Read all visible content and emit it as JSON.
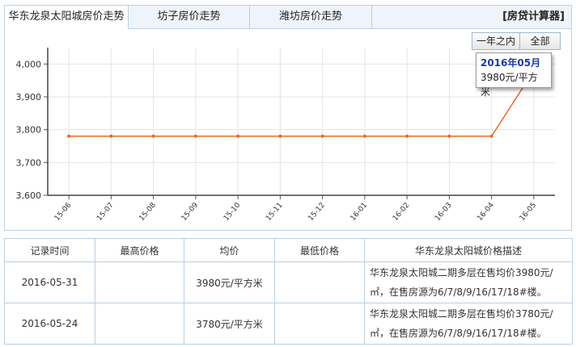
{
  "tabs": [
    {
      "label": "华东龙泉太阳城房价走势",
      "active": true
    },
    {
      "label": "坊子房价走势",
      "active": false
    },
    {
      "label": "潍坊房价走势",
      "active": false
    }
  ],
  "calculator_label": "[房贷计算器]",
  "range_buttons": [
    {
      "label": "一年之内"
    },
    {
      "label": "全部"
    }
  ],
  "tooltip": {
    "date": "2016年05月",
    "value": "3980元/平方米"
  },
  "chart_data": {
    "type": "line",
    "categories": [
      "15-06",
      "15-07",
      "15-08",
      "15-09",
      "15-10",
      "15-11",
      "15-12",
      "16-01",
      "16-02",
      "16-03",
      "16-04",
      "16-05"
    ],
    "series": [
      {
        "values": [
          3780,
          3780,
          3780,
          3780,
          3780,
          3780,
          3780,
          3780,
          3780,
          3780,
          3780,
          3980
        ]
      }
    ],
    "ylim": [
      3600,
      4050
    ],
    "yticks": [
      "3,600",
      "3,700",
      "3,800",
      "3,900",
      "4,000"
    ],
    "ytick_values": [
      3600,
      3700,
      3800,
      3900,
      4000
    ],
    "grid": true,
    "line_color": "#e8692b"
  },
  "table": {
    "headers": [
      "记录时间",
      "最高价格",
      "均价",
      "最低价格",
      "华东龙泉太阳城价格描述"
    ],
    "rows": [
      {
        "date": "2016-05-31",
        "high": "",
        "avg": "3980元/平方米",
        "low": "",
        "desc": "华东龙泉太阳城二期多层在售均价3980元/㎡，在售房源为6/7/8/9/16/17/18#楼。"
      },
      {
        "date": "2016-05-24",
        "high": "",
        "avg": "3780元/平方米",
        "low": "",
        "desc": "华东龙泉太阳城二期多层在售均价3780元/㎡，在售房源为6/7/8/9/16/17/18#楼。"
      }
    ]
  }
}
